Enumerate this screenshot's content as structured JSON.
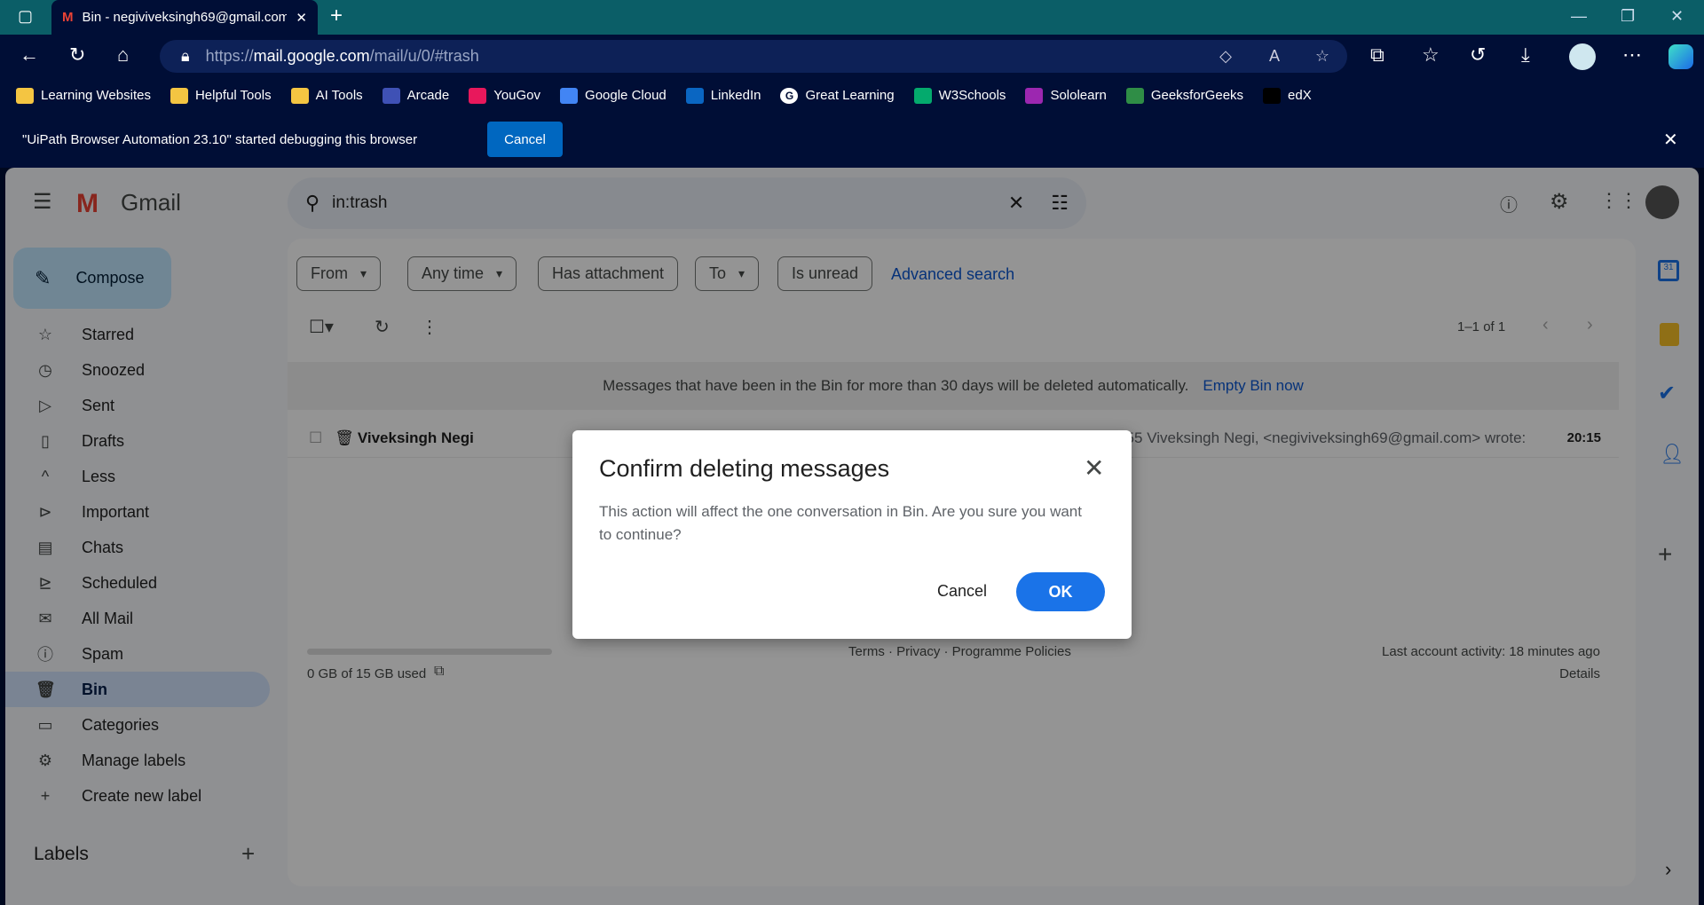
{
  "browser": {
    "tab_title": "Bin - negiviveksingh69@gmail.com",
    "url_prefix": "https://",
    "url_host": "mail.google.com",
    "url_path": "/mail/u/0/#trash",
    "bookmarks": [
      {
        "label": "Learning Websites",
        "icon": "folder-icon",
        "color": "#f4c542"
      },
      {
        "label": "Helpful Tools",
        "icon": "folder-icon",
        "color": "#f4c542"
      },
      {
        "label": "AI Tools",
        "icon": "folder-icon",
        "color": "#f4c542"
      },
      {
        "label": "Arcade",
        "icon": "arcade-icon",
        "color": "#3f51b5"
      },
      {
        "label": "YouGov",
        "icon": "yougov-icon",
        "color": "#e8185c"
      },
      {
        "label": "Google Cloud",
        "icon": "google-cloud-icon",
        "color": "#4285f4"
      },
      {
        "label": "LinkedIn",
        "icon": "linkedin-icon",
        "color": "#0a66c2"
      },
      {
        "label": "Great Learning",
        "icon": "great-learning-icon",
        "color": "#ffffff"
      },
      {
        "label": "W3Schools",
        "icon": "w3schools-icon",
        "color": "#04aa6d"
      },
      {
        "label": "Sololearn",
        "icon": "sololearn-icon",
        "color": "#9c27b0"
      },
      {
        "label": "GeeksforGeeks",
        "icon": "geeksforgeeks-icon",
        "color": "#2f8d46"
      },
      {
        "label": "edX",
        "icon": "edx-icon",
        "color": "#000000"
      }
    ],
    "debug_message": "\"UiPath Browser Automation 23.10\" started debugging this browser",
    "debug_cancel": "Cancel"
  },
  "gmail": {
    "logo_text": "Gmail",
    "search_value": "in:trash",
    "compose": "Compose",
    "sidebar": [
      {
        "label": "Starred",
        "icon": "☆"
      },
      {
        "label": "Snoozed",
        "icon": "◷"
      },
      {
        "label": "Sent",
        "icon": "▷"
      },
      {
        "label": "Drafts",
        "icon": "▯"
      },
      {
        "label": "Less",
        "icon": "^"
      },
      {
        "label": "Important",
        "icon": "⊳"
      },
      {
        "label": "Chats",
        "icon": "▤"
      },
      {
        "label": "Scheduled",
        "icon": "⊵"
      },
      {
        "label": "All Mail",
        "icon": "✉"
      },
      {
        "label": "Spam",
        "icon": "ⓘ"
      },
      {
        "label": "Bin",
        "icon": "🗑",
        "active": true
      },
      {
        "label": "Categories",
        "icon": "▭"
      },
      {
        "label": "Manage labels",
        "icon": "⚙"
      },
      {
        "label": "Create new label",
        "icon": "+"
      }
    ],
    "labels_heading": "Labels",
    "filters": [
      {
        "label": "From",
        "dropdown": true
      },
      {
        "label": "Any time",
        "dropdown": true
      },
      {
        "label": "Has attachment",
        "dropdown": false
      },
      {
        "label": "To",
        "dropdown": true
      },
      {
        "label": "Is unread",
        "dropdown": false
      }
    ],
    "advanced_search": "Advanced search",
    "pagination": "1–1 of 1",
    "banner_text": "Messages that have been in the Bin for more than 30 days will be deleted automatically.",
    "empty_bin": "Empty Bin now",
    "email": {
      "sender": "Viveksingh Negi",
      "snippet": "Re: Viveknegi78678@gmail.com - Hello On Wed, 6 Mar 2024, 19:55 Viveksingh Negi, <negiviveksingh69@gmail.com> wrote:",
      "time": "20:15"
    },
    "storage": "0 GB of 15 GB used",
    "storage_fraction": 0,
    "footer_links": "Terms · Privacy · Programme Policies",
    "last_activity": "Last account activity: 18 minutes ago",
    "details": "Details",
    "accent": "#0b57d0"
  },
  "dialog": {
    "title": "Confirm deleting messages",
    "body": "This action will affect the one conversation in Bin. Are you sure you want to continue?",
    "cancel": "Cancel",
    "ok": "OK"
  }
}
